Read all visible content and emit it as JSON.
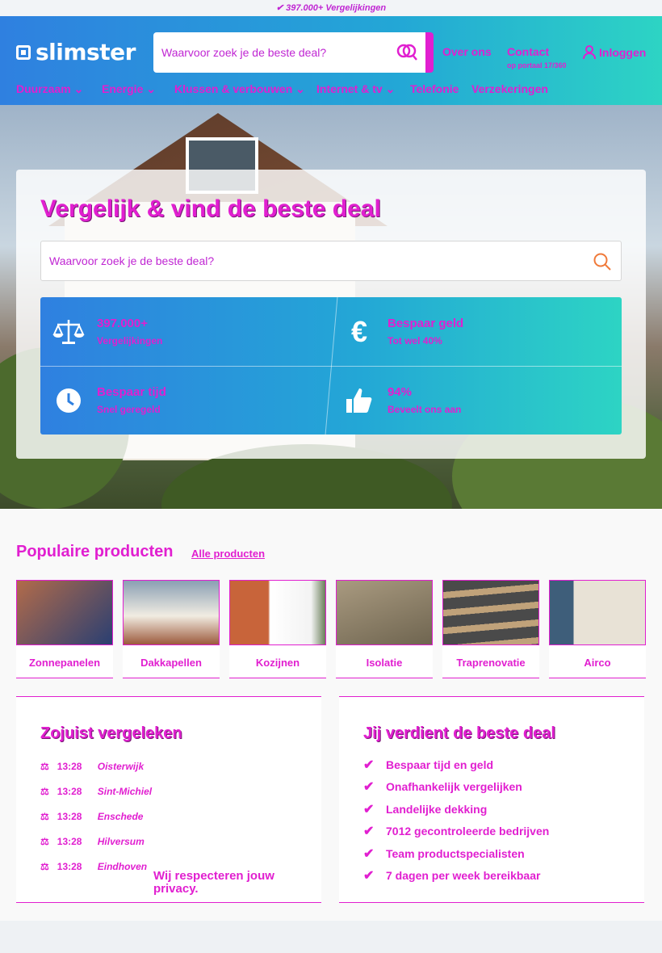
{
  "topbar": {
    "text": "✔ 397.000+ Vergelijkingen"
  },
  "header": {
    "logo": "slimster",
    "search_placeholder": "Waarvoor zoek je de beste deal?",
    "links": {
      "about": "Over ons",
      "contact": "Contact",
      "contact_sub": "op portaal 17/360",
      "login": "Inloggen"
    },
    "nav": [
      "Duurzaam",
      "Energie",
      "Klussen & verbouwen",
      "Internet & tv",
      "Telefonie",
      "Verzekeringen"
    ]
  },
  "hero": {
    "title": "Vergelijk & vind de beste deal",
    "search_placeholder": "Waarvoor zoek je de beste deal?",
    "stats": [
      {
        "title_a": "397.000+",
        "title_b": "",
        "sub": "Vergelijkingen",
        "icon": "scale-icon"
      },
      {
        "title_a": "Bespaar ",
        "title_b": "geld",
        "sub": "Tot wel 40%",
        "icon": "euro-icon"
      },
      {
        "title_a": "Bespaar ",
        "title_b": "tijd",
        "sub": "Snel geregeld",
        "icon": "clock-icon"
      },
      {
        "title_a": "94%",
        "title_b": "",
        "sub": "Beveelt ons aan",
        "icon": "thumbs-up-icon"
      }
    ]
  },
  "products": {
    "title": "Populaire producten",
    "all_link": "Alle producten",
    "items": [
      "Zonnepanelen",
      "Dakkapellen",
      "Kozijnen",
      "Isolatie",
      "Traprenovatie",
      "Airco"
    ]
  },
  "recent": {
    "title": "Zojuist vergeleken",
    "rows": [
      {
        "time": "13:28",
        "place": "Oisterwijk"
      },
      {
        "time": "13:28",
        "place": "Sint-Michiel"
      },
      {
        "time": "13:28",
        "place": "Enschede"
      },
      {
        "time": "13:28",
        "place": "Hilversum"
      },
      {
        "time": "13:28",
        "place": "Eindhoven"
      }
    ],
    "privacy": "Wij respecteren jouw privacy."
  },
  "benefits": {
    "title": "Jij verdient de beste deal",
    "items": [
      "Bespaar tijd en geld",
      "Onafhankelijk vergelijken",
      "Landelijke dekking",
      "7012 gecontroleerde bedrijven",
      "Team productspecialisten",
      "7 dagen per week bereikbaar"
    ]
  },
  "colors": {
    "accent": "#e11fd0",
    "gradient_start": "#2f80e0",
    "gradient_end": "#2dd4c4"
  }
}
